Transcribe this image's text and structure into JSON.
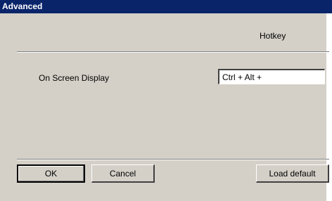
{
  "dialog": {
    "title": "Advanced"
  },
  "table": {
    "column_header": "Hotkey",
    "rows": [
      {
        "label": "On Screen Display",
        "value": "Ctrl + Alt + "
      }
    ]
  },
  "buttons": {
    "ok_label": "OK",
    "cancel_label": "Cancel",
    "load_default_label": "Load default"
  },
  "colors": {
    "title_bar": "#0a246a",
    "dialog_face": "#d4d0c8",
    "title_text": "#ffffff"
  }
}
